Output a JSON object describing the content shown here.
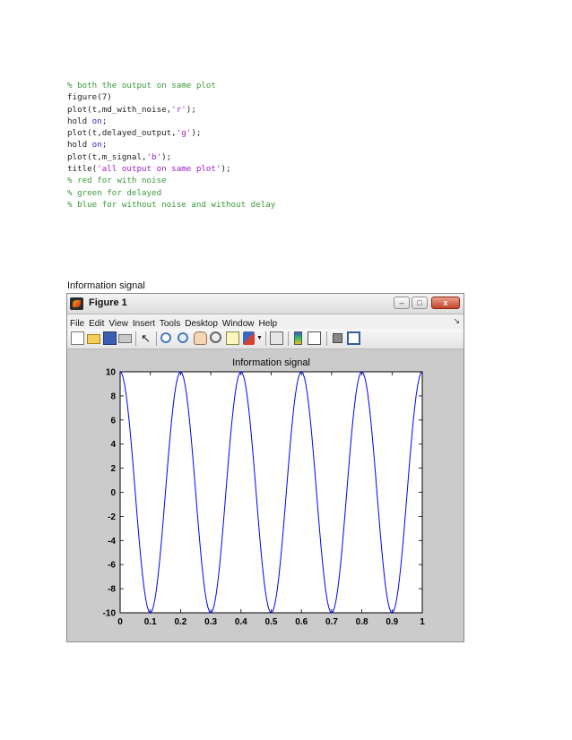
{
  "code_lines": [
    [
      {
        "t": "% both the output on same plot",
        "c": "comment"
      }
    ],
    [
      {
        "t": "figure(7)",
        "c": "code"
      }
    ],
    [
      {
        "t": "plot(t,md_with_noise,",
        "c": "code"
      },
      {
        "t": "'r'",
        "c": "str"
      },
      {
        "t": ");",
        "c": "code"
      }
    ],
    [
      {
        "t": "hold ",
        "c": "code"
      },
      {
        "t": "on",
        "c": "kw"
      },
      {
        "t": ";",
        "c": "code"
      }
    ],
    [
      {
        "t": "plot(t,delayed_output,",
        "c": "code"
      },
      {
        "t": "'g'",
        "c": "str"
      },
      {
        "t": ");",
        "c": "code"
      }
    ],
    [
      {
        "t": "hold ",
        "c": "code"
      },
      {
        "t": "on",
        "c": "kw"
      },
      {
        "t": ";",
        "c": "code"
      }
    ],
    [
      {
        "t": "plot(t,m_signal,",
        "c": "code"
      },
      {
        "t": "'b'",
        "c": "str"
      },
      {
        "t": ");",
        "c": "code"
      }
    ],
    [
      {
        "t": "title(",
        "c": "code"
      },
      {
        "t": "'all output on same plot'",
        "c": "str"
      },
      {
        "t": ");",
        "c": "code"
      }
    ],
    [
      {
        "t": "% red for with noise",
        "c": "comment"
      }
    ],
    [
      {
        "t": "% green for delayed",
        "c": "comment"
      }
    ],
    [
      {
        "t": "% blue for without noise and without delay",
        "c": "comment"
      }
    ]
  ],
  "caption": "Information signal",
  "window": {
    "title": "Figure 1",
    "menu": [
      "File",
      "Edit",
      "View",
      "Insert",
      "Tools",
      "Desktop",
      "Window",
      "Help"
    ],
    "controls": {
      "minimize": "–",
      "maximize": "□",
      "close": "x"
    },
    "menu_dock_arrow": "↘",
    "toolbar_icons": [
      "new-figure",
      "open-file",
      "save-figure",
      "print-figure",
      "edit-plot-arrow",
      "zoom-in",
      "zoom-out",
      "pan-hand",
      "rotate-3d",
      "data-cursor",
      "brush",
      "brush-dropdown",
      "link-plot",
      "colorbar",
      "legend",
      "hide-plot-tools",
      "show-plot-tools"
    ]
  },
  "chart_data": {
    "type": "line",
    "title": "Information signal",
    "xlabel": "",
    "ylabel": "",
    "xlim": [
      0,
      1
    ],
    "ylim": [
      -10,
      10
    ],
    "x_ticks": [
      "0",
      "0.1",
      "0.2",
      "0.3",
      "0.4",
      "0.5",
      "0.6",
      "0.7",
      "0.8",
      "0.9",
      "1"
    ],
    "y_ticks": [
      "-10",
      "-8",
      "-6",
      "-4",
      "-2",
      "0",
      "2",
      "4",
      "6",
      "8",
      "10"
    ],
    "grid": false,
    "series": [
      {
        "function": "cos",
        "amplitude": 10,
        "frequency": 5,
        "color": "#0000ff",
        "sample_count": 201
      }
    ]
  }
}
